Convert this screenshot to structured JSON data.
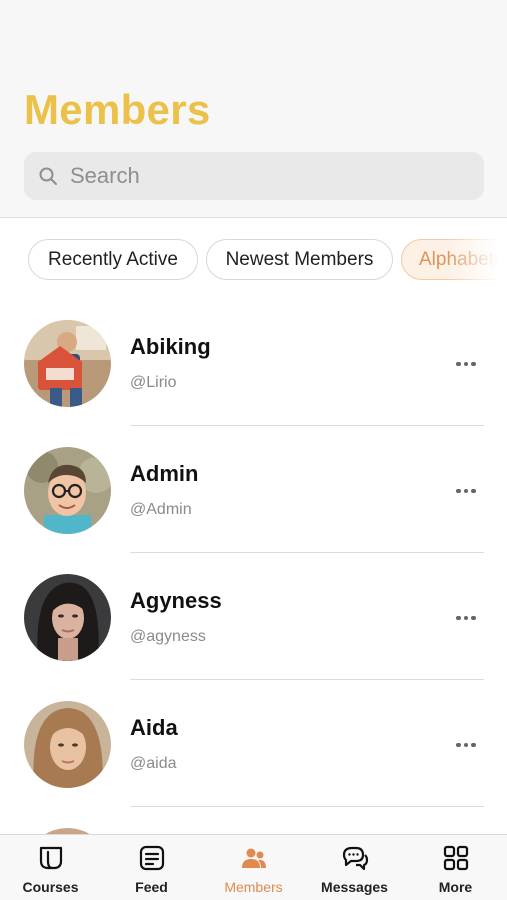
{
  "header": {
    "title": "Members",
    "title_color": "#ecc14a"
  },
  "search": {
    "placeholder": "Search",
    "icon": "search-icon"
  },
  "filters": [
    {
      "label": "Recently Active",
      "active": false
    },
    {
      "label": "Newest Members",
      "active": false
    },
    {
      "label": "Alphabetical",
      "active": true
    }
  ],
  "members": [
    {
      "name": "Abiking",
      "handle": "@Lirio"
    },
    {
      "name": "Admin",
      "handle": "@Admin"
    },
    {
      "name": "Agyness",
      "handle": "@agyness"
    },
    {
      "name": "Aida",
      "handle": "@aida"
    }
  ],
  "tabbar": {
    "active_color": "#e08a50",
    "items": [
      {
        "label": "Courses",
        "icon": "courses-icon"
      },
      {
        "label": "Feed",
        "icon": "feed-icon"
      },
      {
        "label": "Members",
        "icon": "members-icon",
        "active": true
      },
      {
        "label": "Messages",
        "icon": "messages-icon"
      },
      {
        "label": "More",
        "icon": "grid-icon"
      }
    ]
  }
}
